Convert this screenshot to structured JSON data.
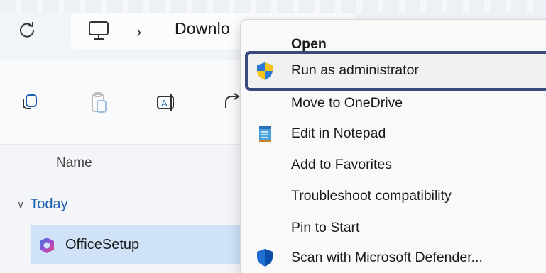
{
  "explorer": {
    "breadcrumb": "Downlo",
    "column_header": "Name",
    "group_label": "Today",
    "selected_file": "OfficeSetup"
  },
  "icons": {
    "refresh": "refresh-icon",
    "this_pc": "monitor-icon",
    "copy": "copy-icon",
    "paste": "paste-icon",
    "rename": "rename-icon",
    "share": "share-icon",
    "file": "office-logo-icon",
    "shield": "uac-shield-icon",
    "notepad": "notepad-icon",
    "defender": "defender-shield-icon"
  },
  "context_menu": {
    "items": [
      {
        "label": "Open"
      },
      {
        "label": "Run as administrator"
      },
      {
        "label": "Move to OneDrive"
      },
      {
        "label": "Edit in Notepad"
      },
      {
        "label": "Add to Favorites"
      },
      {
        "label": "Troubleshoot compatibility"
      },
      {
        "label": "Pin to Start"
      },
      {
        "label": "Scan with Microsoft Defender..."
      }
    ]
  },
  "colors": {
    "highlight_border": "#3b4a7d",
    "group_label": "#1d5fb0",
    "selection_bg": "#cfe2f7"
  }
}
